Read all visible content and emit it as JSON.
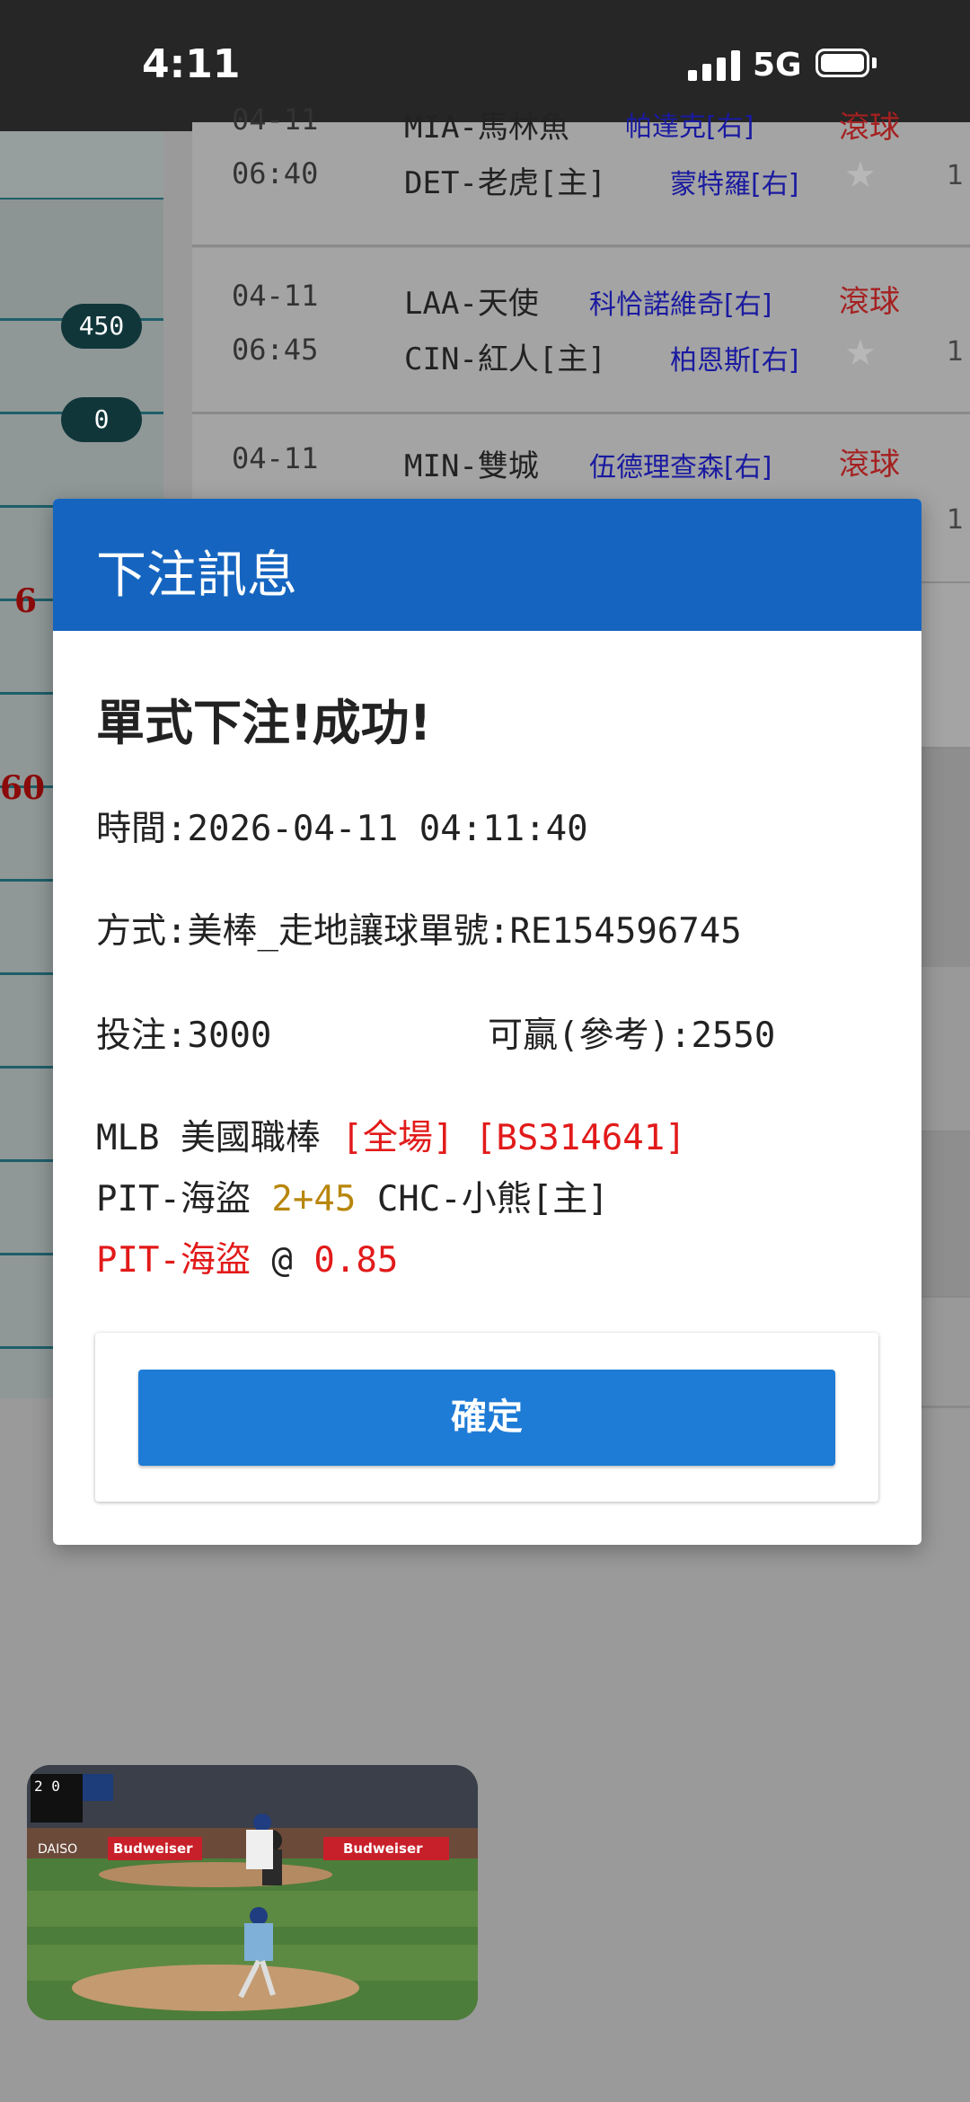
{
  "status_bar": {
    "time": "4:11",
    "network": "5G"
  },
  "background_left": {
    "pills": [
      "450",
      "0"
    ],
    "red_numbers": [
      "6",
      "60"
    ]
  },
  "background_matches": [
    {
      "date": "04-11",
      "time": "06:40",
      "away_team": "MIA-馬林魚",
      "away_pitcher": "帕達克[右]",
      "home_team": "DET-老虎[主]",
      "home_pitcher": "蒙特羅[右]",
      "live": "滾球",
      "edge": "1"
    },
    {
      "date": "04-11",
      "time": "06:45",
      "away_team": "LAA-天使",
      "away_pitcher": "科恰諾維奇[右]",
      "home_team": "CIN-紅人[主]",
      "home_pitcher": "柏恩斯[右]",
      "live": "滾球",
      "edge": "1"
    },
    {
      "date": "04-11",
      "time": "",
      "away_team": "MIN-雙城",
      "away_pitcher": "伍德理查森[右]",
      "home_team": "",
      "home_pitcher": "",
      "live": "滾球",
      "edge": "1"
    }
  ],
  "dialog": {
    "title": "下注訊息",
    "result": "單式下注!成功!",
    "time_line": "時間:2026-04-11 04:11:40",
    "method_line": "方式:美棒_走地讓球單號:RE154596745",
    "stake_label": "投注:3000",
    "win_label": "可贏(參考):2550",
    "league": "MLB 美國職棒",
    "period": "[全場]",
    "ticket": "[BS314641]",
    "away": "PIT-海盜",
    "handicap": "2+45",
    "home": "CHC-小熊[主]",
    "pick": "PIT-海盜",
    "at": "@",
    "odds": "0.85",
    "confirm_label": "確定"
  },
  "video": {
    "scoreboard": "2 0",
    "ad_text": "Budweiser",
    "sponsor": "DAISO"
  }
}
